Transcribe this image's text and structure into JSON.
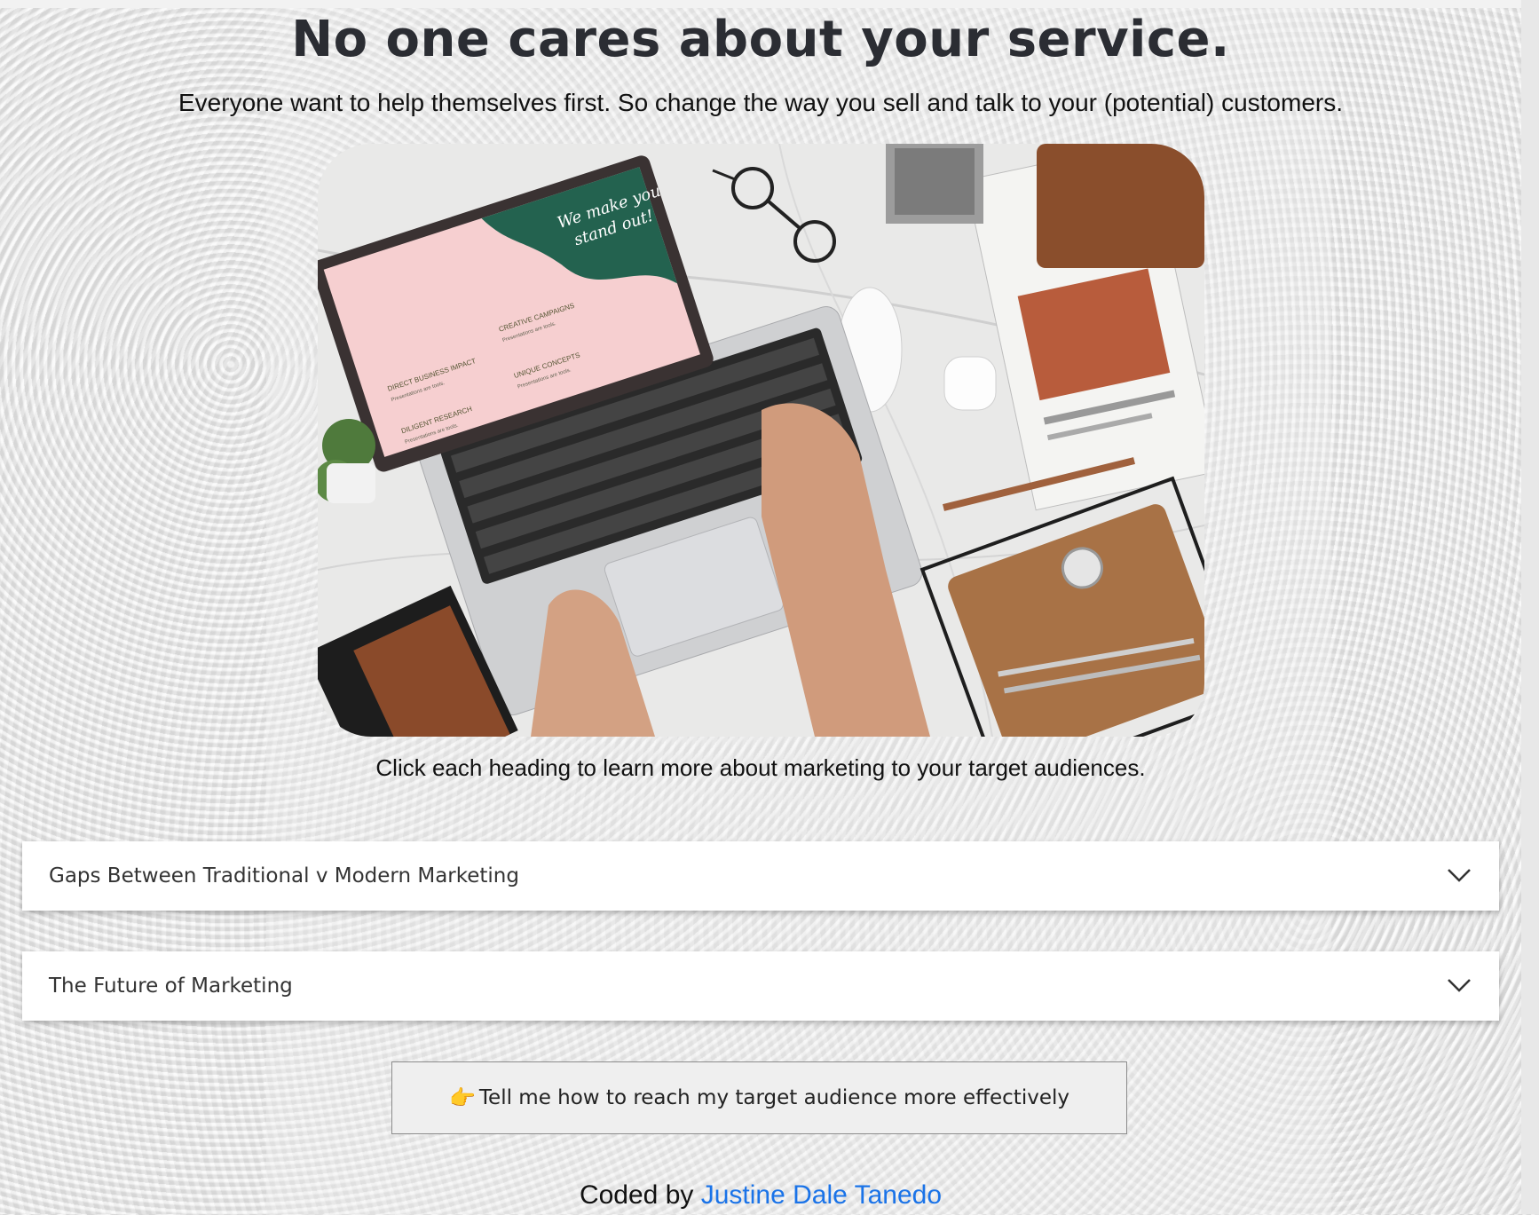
{
  "header": {
    "title": "No one cares about your service.",
    "subtitle": "Everyone want to help themselves first. So change the way you sell and talk to your (potential) customers."
  },
  "hero": {
    "laptop_screen": {
      "tagline_line1": "We make you",
      "tagline_line2": "stand out!",
      "items": [
        {
          "heading": "CREATIVE CAMPAIGNS",
          "sub": "Presentations are tools."
        },
        {
          "heading": "DIRECT BUSINESS IMPACT",
          "sub": "Presentations are tools."
        },
        {
          "heading": "UNIQUE CONCEPTS",
          "sub": "Presentations are tools."
        },
        {
          "heading": "DILIGENT RESEARCH",
          "sub": "Presentations are tools."
        }
      ]
    }
  },
  "caption": "Click each heading to learn more about marketing to your target audiences.",
  "accordions": [
    {
      "label": "Gaps Between Traditional v Modern Marketing",
      "icon": "chevron-down-icon"
    },
    {
      "label": "The Future of Marketing",
      "icon": "chevron-down-icon"
    }
  ],
  "cta": {
    "emoji": "👉",
    "label": "Tell me how to reach my target audience more effectively"
  },
  "footer": {
    "prefix": "Coded by ",
    "author": "Justine Dale Tanedo"
  },
  "colors": {
    "link": "#1a73e8",
    "title": "#2b2d33",
    "screen_green": "#23624f",
    "screen_pink": "#f6cfd0"
  }
}
